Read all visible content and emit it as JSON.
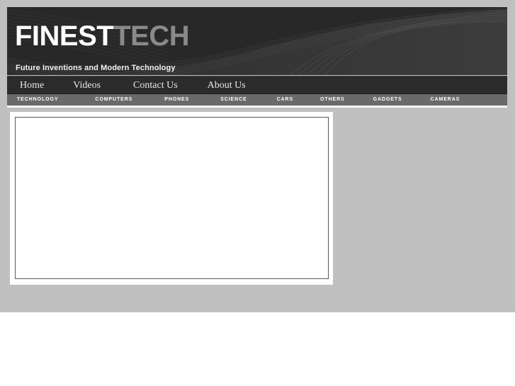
{
  "site": {
    "brand_primary": "FINEST",
    "brand_secondary": "TECH",
    "tagline": "Future Inventions and Modern Technology"
  },
  "colors": {
    "page_background": "#c0c0c0",
    "masthead_background": "#282828",
    "primary_nav_background": "#2b2b2b",
    "category_nav_background": "#6a6a6a",
    "brand_primary_color": "#ffffff",
    "brand_secondary_color": "#8a8a8a",
    "content_background": "#ffffff",
    "content_border": "#595959",
    "nav_text_color": "#e6e6e6",
    "category_text_color": "#ffffff"
  },
  "primary_nav": {
    "items": [
      {
        "label": "Home"
      },
      {
        "label": "Videos"
      },
      {
        "label": "Contact Us"
      },
      {
        "label": "About Us"
      }
    ]
  },
  "category_nav": {
    "items": [
      {
        "label": "TECHNOLOGY"
      },
      {
        "label": "COMPUTERS"
      },
      {
        "label": "PHONES"
      },
      {
        "label": "SCIENCE"
      },
      {
        "label": "CARS"
      },
      {
        "label": "OTHERS"
      },
      {
        "label": "GADGETS"
      },
      {
        "label": "CAMERAS"
      }
    ]
  },
  "main_content": {
    "placeholder_text": ""
  }
}
